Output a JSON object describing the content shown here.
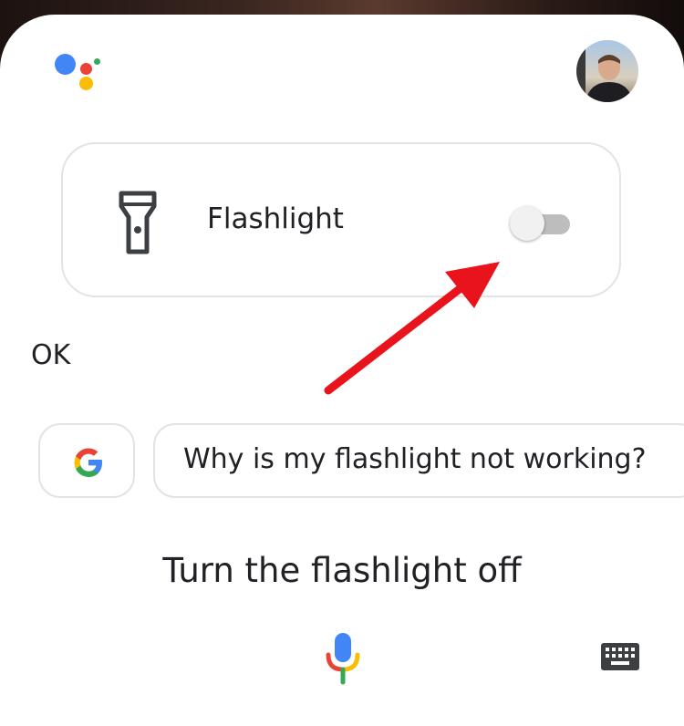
{
  "card": {
    "label": "Flashlight",
    "toggle_state": "off"
  },
  "response": {
    "text": "OK"
  },
  "suggestions": {
    "chip_text": "Why is my flashlight not working?"
  },
  "query": {
    "text": "Turn the flashlight off"
  },
  "colors": {
    "google_blue": "#4285F4",
    "google_red": "#EA4335",
    "google_yellow": "#FBBC05",
    "google_green": "#34A853",
    "annotation_arrow": "#E8131B"
  },
  "icons": {
    "assistant": "google-assistant-icon",
    "avatar": "avatar",
    "flashlight": "flashlight-icon",
    "google": "google-g-icon",
    "mic": "mic-icon",
    "keyboard": "keyboard-icon"
  }
}
